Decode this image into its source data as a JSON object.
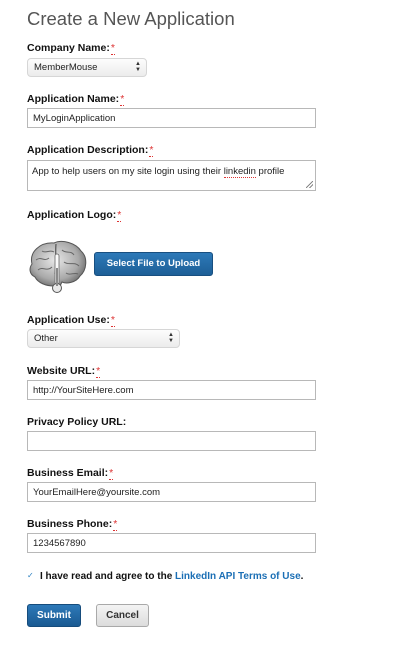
{
  "title": "Create a New Application",
  "required_mark": "*",
  "company": {
    "label": "Company Name:",
    "selected": "MemberMouse"
  },
  "app_name": {
    "label": "Application Name:",
    "value": "MyLoginApplication"
  },
  "description": {
    "label": "Application Description:",
    "value_start": "App to help users on my site login using their ",
    "value_flagged": "linkedin",
    "value_end": " profile"
  },
  "logo": {
    "label": "Application Logo:",
    "upload_button": "Select File to Upload"
  },
  "app_use": {
    "label": "Application Use:",
    "selected": "Other"
  },
  "website": {
    "label": "Website URL:",
    "value": "http://YourSiteHere.com"
  },
  "privacy": {
    "label": "Privacy Policy URL:",
    "value": ""
  },
  "email": {
    "label": "Business Email:",
    "value": "YourEmailHere@yoursite.com"
  },
  "phone": {
    "label": "Business Phone:",
    "value": "1234567890"
  },
  "agreement": {
    "text": "I have read and agree to the ",
    "link": "LinkedIn API Terms of Use",
    "end": "."
  },
  "buttons": {
    "submit": "Submit",
    "cancel": "Cancel"
  }
}
